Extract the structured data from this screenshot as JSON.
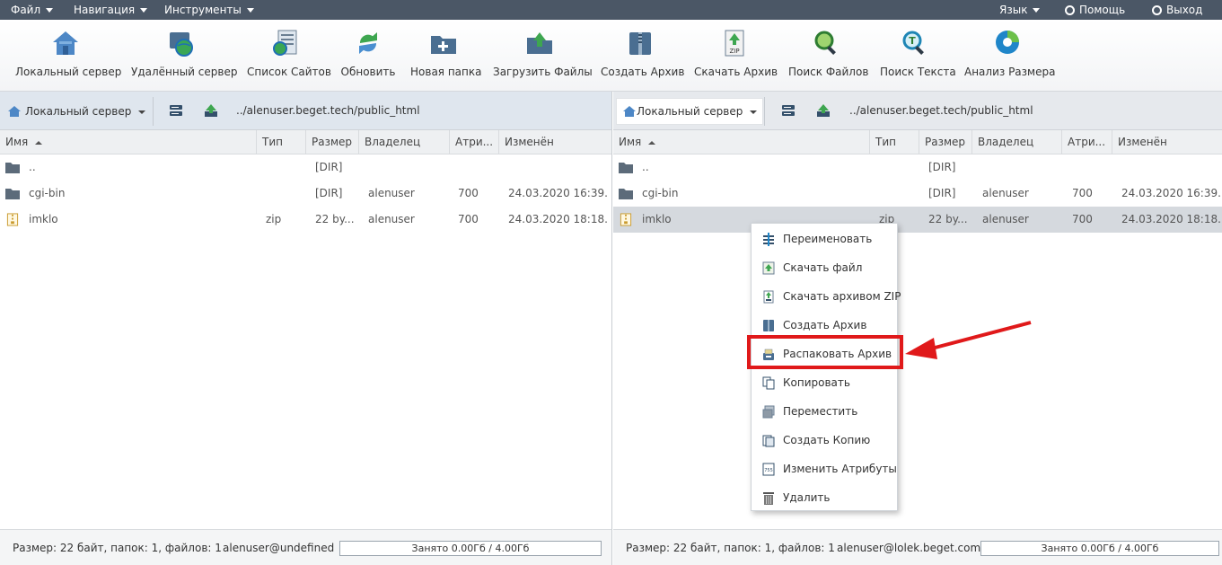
{
  "menubar": {
    "file": "Файл",
    "navigation": "Навигация",
    "tools": "Инструменты",
    "language": "Язык",
    "help": "Помощь",
    "logout": "Выход"
  },
  "toolbar": [
    {
      "label": "Локальный сервер",
      "icon": "home-icon"
    },
    {
      "label": "Удалённый сервер",
      "icon": "remote-server-icon"
    },
    {
      "label": "Список Сайтов",
      "icon": "sites-list-icon"
    },
    {
      "label": "Обновить",
      "icon": "refresh-icon"
    },
    {
      "label": "Новая папка",
      "icon": "new-folder-icon"
    },
    {
      "label": "Загрузить Файлы",
      "icon": "upload-icon"
    },
    {
      "label": "Создать Архив",
      "icon": "archive-icon"
    },
    {
      "label": "Скачать Архив",
      "icon": "zip-download-icon"
    },
    {
      "label": "Поиск Файлов",
      "icon": "file-search-icon"
    },
    {
      "label": "Поиск Текста",
      "icon": "text-search-icon"
    },
    {
      "label": "Анализ Размера",
      "icon": "pie-chart-icon"
    }
  ],
  "columns": {
    "name": "Имя",
    "type": "Тип",
    "size": "Размер",
    "owner": "Владелец",
    "attrs": "Атри...",
    "modified": "Изменён"
  },
  "left": {
    "server": "Локальный сервер",
    "path": "../alenuser.beget.tech/public_html",
    "files": [
      {
        "name": "..",
        "type": "",
        "size": "[DIR]",
        "owner": "",
        "attrs": "",
        "modified": ""
      },
      {
        "name": "cgi-bin",
        "type": "",
        "size": "[DIR]",
        "owner": "alenuser",
        "attrs": "700",
        "modified": "24.03.2020 16:39..."
      },
      {
        "name": "imklo",
        "type": "zip",
        "size": "22 by...",
        "owner": "alenuser",
        "attrs": "700",
        "modified": "24.03.2020 18:18..."
      }
    ],
    "status": "Размер: 22 байт, папок: 1, файлов: 1",
    "user": "alenuser@undefined",
    "quota": "Занято 0.00Гб / 4.00Гб"
  },
  "right": {
    "server": "Локальный сервер",
    "path": "../alenuser.beget.tech/public_html",
    "files": [
      {
        "name": "..",
        "type": "",
        "size": "[DIR]",
        "owner": "",
        "attrs": "",
        "modified": ""
      },
      {
        "name": "cgi-bin",
        "type": "",
        "size": "[DIR]",
        "owner": "alenuser",
        "attrs": "700",
        "modified": "24.03.2020 16:39..."
      },
      {
        "name": "imklo",
        "type": "zip",
        "size": "22 by...",
        "owner": "alenuser",
        "attrs": "700",
        "modified": "24.03.2020 18:18..."
      }
    ],
    "status": "Размер: 22 байт, папок: 1, файлов: 1",
    "user": "alenuser@lolek.beget.com",
    "quota": "Занято 0.00Гб / 4.00Гб"
  },
  "context_menu": [
    {
      "label": "Переименовать",
      "icon": "rename-icon"
    },
    {
      "label": "Скачать файл",
      "icon": "download-file-icon"
    },
    {
      "label": "Скачать архивом ZIP",
      "icon": "download-zip-icon"
    },
    {
      "label": "Создать Архив",
      "icon": "create-archive-icon"
    },
    {
      "label": "Распаковать Архив",
      "icon": "extract-archive-icon"
    },
    {
      "label": "Копировать",
      "icon": "copy-icon"
    },
    {
      "label": "Переместить",
      "icon": "move-icon"
    },
    {
      "label": "Создать Копию",
      "icon": "duplicate-icon"
    },
    {
      "label": "Изменить Атрибуты",
      "icon": "attributes-icon"
    },
    {
      "label": "Удалить",
      "icon": "trash-icon"
    }
  ],
  "colors": {
    "menubar": "#4b5766",
    "highlight": "#e0191a"
  }
}
